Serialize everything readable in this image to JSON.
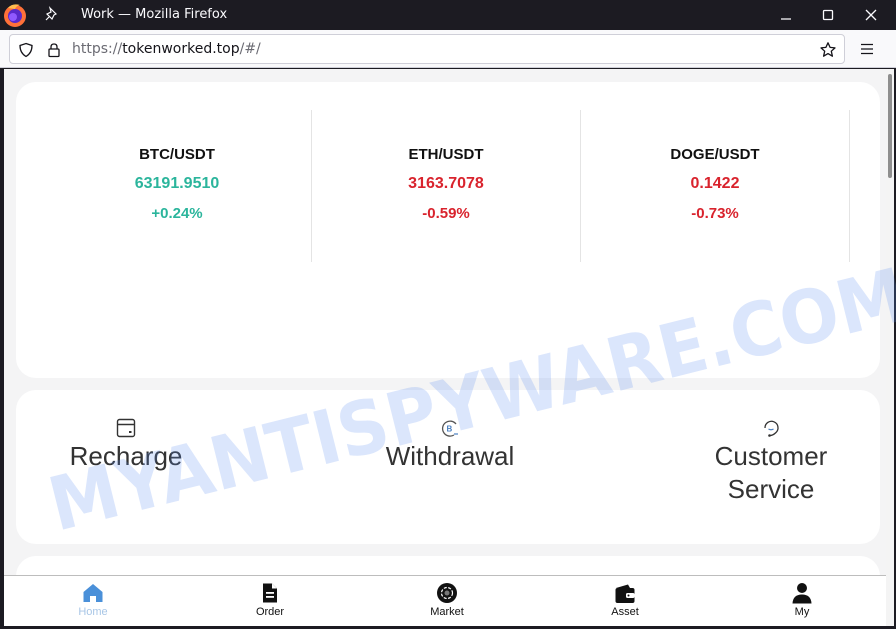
{
  "browser": {
    "window_title": "Work — Mozilla Firefox",
    "url_scheme": "https://",
    "url_host": "tokenworked.top",
    "url_path": "/#/"
  },
  "tickers": [
    {
      "pair": "BTC/USDT",
      "price": "63191.9510",
      "change": "+0.24%",
      "color": "#2bb59c"
    },
    {
      "pair": "ETH/USDT",
      "price": "3163.7078",
      "change": "-0.59%",
      "color": "#d9232d"
    },
    {
      "pair": "DOGE/USDT",
      "price": "0.1422",
      "change": "-0.73%",
      "color": "#d9232d"
    }
  ],
  "actions": [
    {
      "label": "Recharge",
      "icon": "wallet-card-icon"
    },
    {
      "label": "Withdrawal",
      "icon": "bitcoin-withdraw-icon"
    },
    {
      "label_line1": "Customer",
      "label_line2": "Service",
      "icon": "headset-icon"
    }
  ],
  "tabbar": [
    {
      "label": "Home",
      "icon": "home-icon",
      "active": true
    },
    {
      "label": "Order",
      "icon": "document-icon"
    },
    {
      "label": "Market",
      "icon": "market-coin-icon"
    },
    {
      "label": "Asset",
      "icon": "wallet-icon"
    },
    {
      "label": "My",
      "icon": "user-icon"
    }
  ],
  "colors": {
    "up": "#2bb59c",
    "down": "#d9232d",
    "active_tab": "#4a90d9"
  },
  "watermark": "MYANTISPYWARE.COM"
}
